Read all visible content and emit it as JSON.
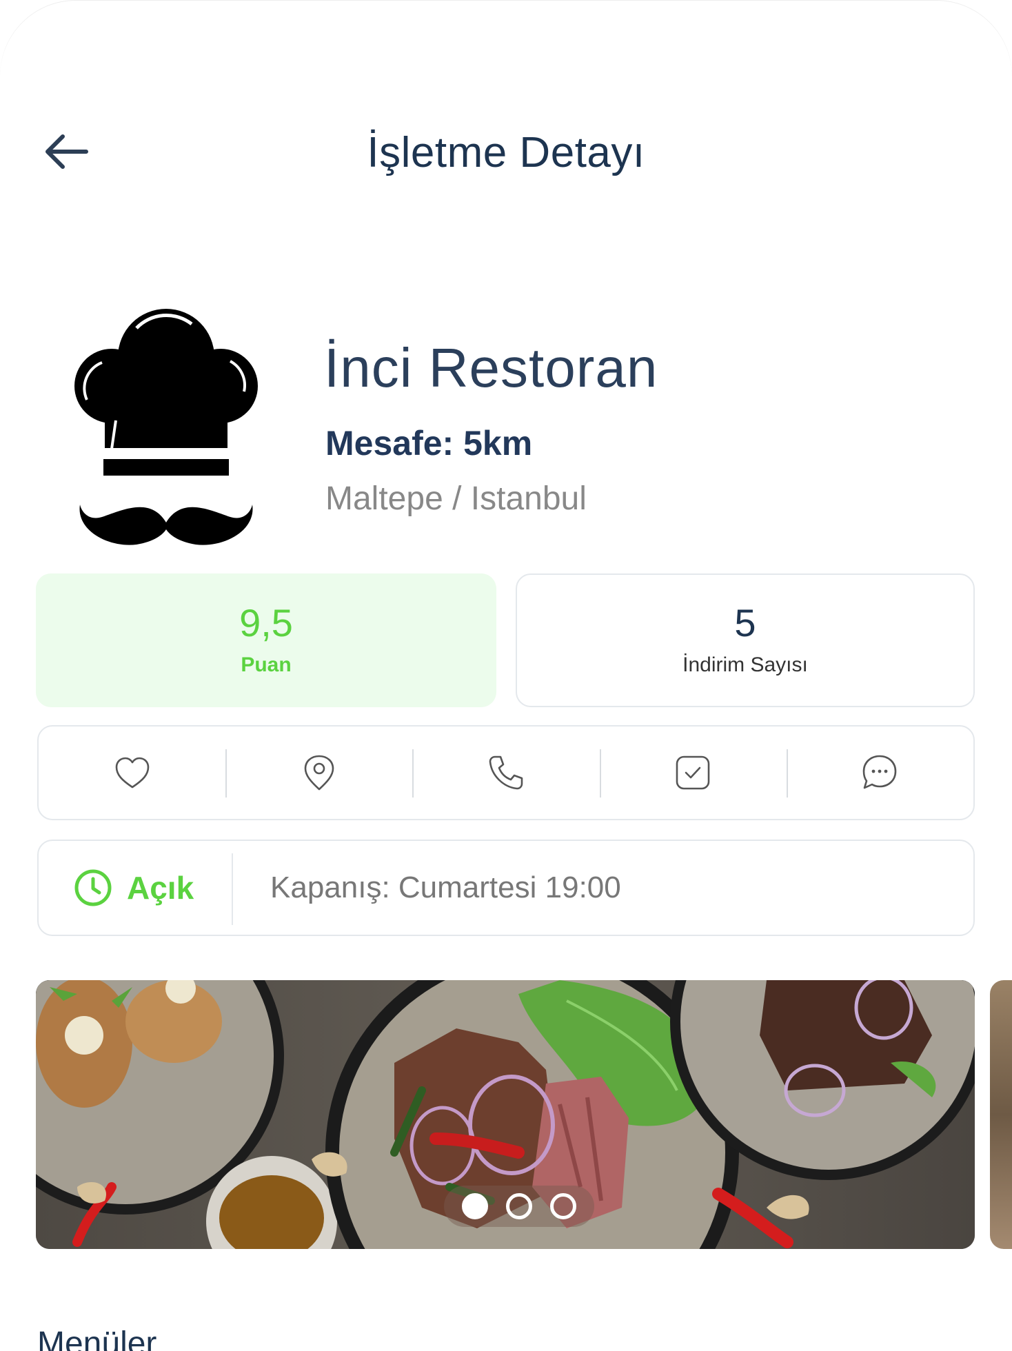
{
  "header": {
    "title": "İşletme Detayı"
  },
  "business": {
    "name": "İnci Restoran",
    "distance": "Mesafe: 5km",
    "location": "Maltepe / Istanbul"
  },
  "stats": {
    "score_value": "9,5",
    "score_label": "Puan",
    "discount_value": "5",
    "discount_label": "İndirim Sayısı"
  },
  "actions": [
    "heart-icon",
    "location-pin-icon",
    "phone-icon",
    "checkbox-icon",
    "chat-icon"
  ],
  "hours": {
    "status": "Açık",
    "closing": "Kapanış: Cumartesi 19:00"
  },
  "carousel": {
    "slide_count": 3,
    "active_index": 0
  },
  "menus": {
    "title": "Menüler"
  },
  "colors": {
    "primary_text": "#1d3450",
    "open_green": "#5bd240",
    "score_bg": "#ecfcec",
    "border": "#e4e8ec"
  }
}
